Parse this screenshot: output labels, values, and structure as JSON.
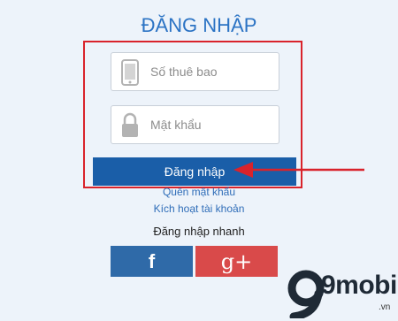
{
  "header": {
    "title": "ĐĂNG NHẬP"
  },
  "form": {
    "phone_placeholder": "Số thuê bao",
    "password_placeholder": "Mật khẩu",
    "login_label": "Đăng nhập"
  },
  "links": {
    "forgot_password": "Quên mật khẩu",
    "activate_account": "Kích hoạt tài khoản"
  },
  "quick_login": {
    "title": "Đăng nhập nhanh",
    "facebook_label": "f",
    "google_label": "g+"
  },
  "icons": {
    "phone": "phone-icon",
    "lock": "lock-icon",
    "arrow": "red-arrow-annotation"
  },
  "colors": {
    "title": "#2b73c4",
    "login_button": "#1a5ea8",
    "facebook": "#2f6aa8",
    "google": "#d94a4a",
    "highlight": "#d9232b"
  },
  "watermark": {
    "logo_text": "9mobi",
    "suffix": ".vn"
  }
}
